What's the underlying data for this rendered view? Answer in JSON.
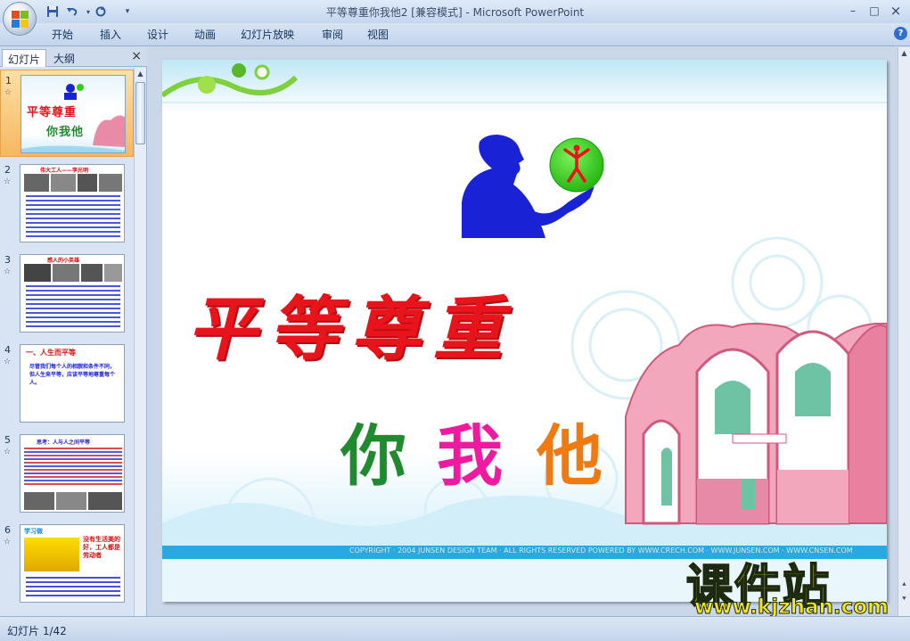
{
  "window": {
    "title": "平等尊重你我他2 [兼容模式] - Microsoft PowerPoint",
    "controls": {
      "minimize": "–",
      "maximize": "□",
      "close": "×"
    }
  },
  "quick_access": {
    "save": "save-icon",
    "undo": "undo-icon",
    "redo": "redo-icon"
  },
  "ribbon": {
    "tabs": [
      "开始",
      "插入",
      "设计",
      "动画",
      "幻灯片放映",
      "审阅",
      "视图"
    ],
    "help": "?"
  },
  "left_pane": {
    "tabs": {
      "slides": "幻灯片",
      "outline": "大纲"
    },
    "close": "×",
    "thumbnails": [
      {
        "number": "1",
        "selected": true
      },
      {
        "number": "2",
        "selected": false
      },
      {
        "number": "3",
        "selected": false
      },
      {
        "number": "4",
        "selected": false
      },
      {
        "number": "5",
        "selected": false
      },
      {
        "number": "6",
        "selected": false
      }
    ],
    "thumb_texts": {
      "t1_title": "平等尊重",
      "t1_sub": "你我他",
      "t2_header": "伟大工人——李光明",
      "t3_header": "感人的小英雄",
      "t4_header": "一、人生而平等",
      "t4_body": "尽管我们每个人的相貌和条件不同，但人生来平等，应该平等地尊重每个人。",
      "t5_header": "思考：人与人之间平等",
      "t6_header": "学习做",
      "t6_side": "没有生活美的好，工人都是劳动者"
    }
  },
  "slide": {
    "title": "平等尊重",
    "sub": [
      "你",
      "我",
      "他"
    ],
    "colors": {
      "title": "#e8141b",
      "ni": "#1f8a2e",
      "wo": "#f01aa0",
      "ta": "#f07a12",
      "person": "#1a22d6",
      "globe": "#33cc1a"
    },
    "footer_text": "COPYRIGHT · 2004 JUNSEN DESIGN TEAM · ALL RIGHTS RESERVED      POWERED BY WWW.CRECH.COM · WWW.JUNSEN.COM · WWW.CNSEN.COM"
  },
  "watermark": {
    "cn": "课件站",
    "url": "www.kjzhan.com"
  },
  "status_bar": {
    "slide_counter": "幻灯片 1/42"
  }
}
